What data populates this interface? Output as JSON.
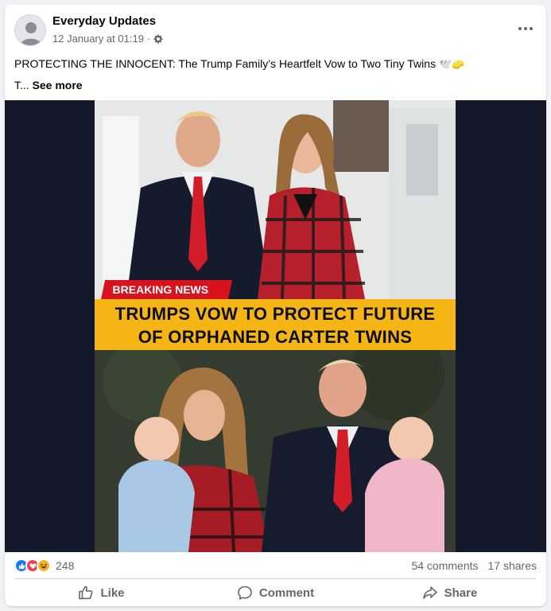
{
  "post": {
    "author": "Everyday Updates",
    "timestamp": "12 January at 01:19",
    "separator": "·",
    "audience_icon": "gear-icon",
    "more_icon": "more-options-icon",
    "caption_line1": "PROTECTING THE INNOCENT: The Trump Family’s Heartfelt Vow to Two Tiny Twins",
    "caption_emojis": "🕊️🧽",
    "caption_line2_prefix": "T...",
    "see_more": "See more"
  },
  "media": {
    "breaking_label": "BREAKING NEWS",
    "headline_line1": "TRUMPS VOW TO PROTECT FUTURE",
    "headline_line2": "OF ORPHANED CARTER TWINS"
  },
  "engagement": {
    "reaction_icons": [
      "like-icon",
      "love-icon",
      "haha-icon"
    ],
    "reaction_count": "248",
    "comments": "54 comments",
    "shares": "17 shares"
  },
  "actions": {
    "like": "Like",
    "comment": "Comment",
    "share": "Share"
  },
  "colors": {
    "like_blue": "#1877f2",
    "love_red": "#f33e58",
    "haha_yellow": "#f7b125",
    "banner_yellow": "#f5b515",
    "breaking_red": "#d7141e",
    "media_bg": "#12172a"
  }
}
